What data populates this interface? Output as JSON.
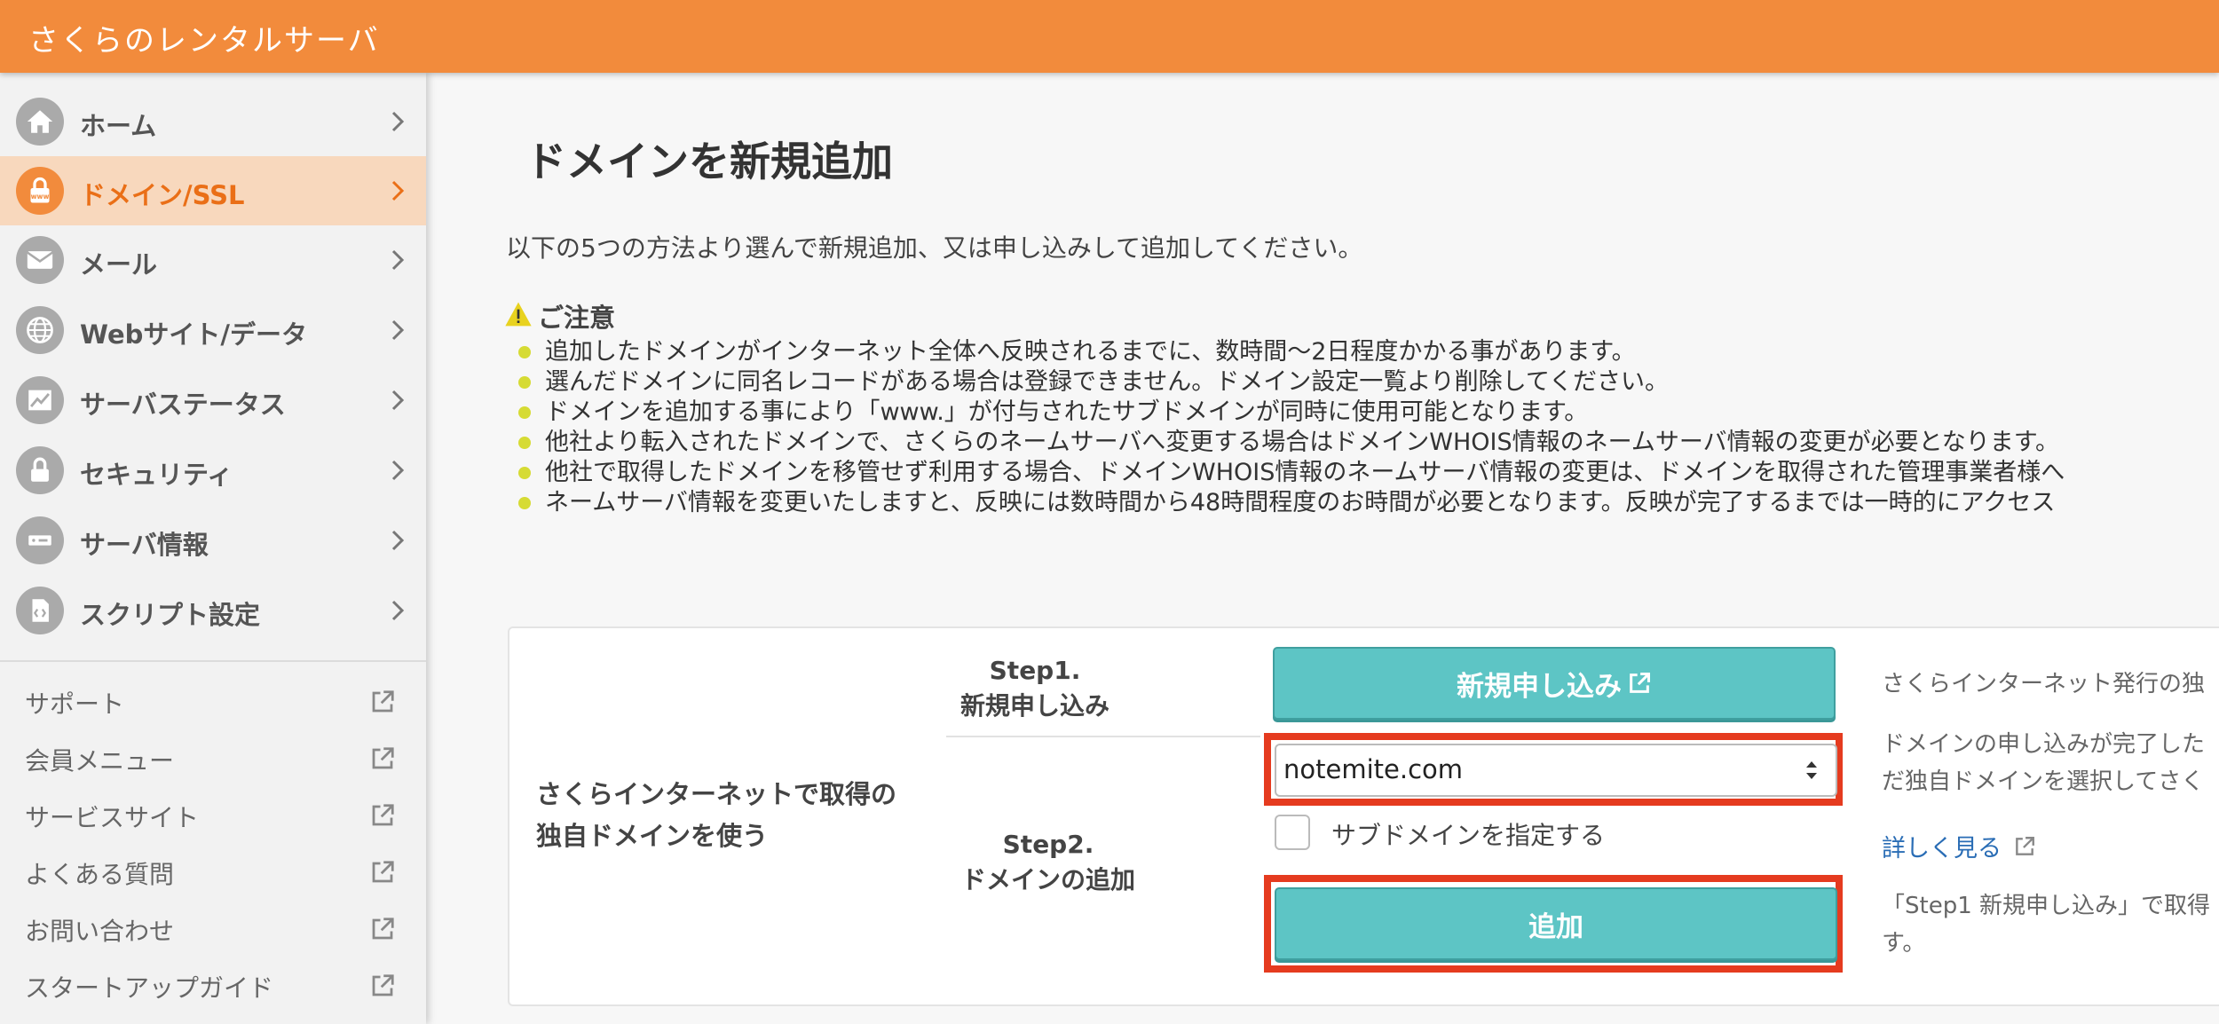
{
  "app": {
    "title": "さくらのレンタルサーバ"
  },
  "sidebar": {
    "items": [
      {
        "label": "ホーム",
        "icon": "home-icon"
      },
      {
        "label": "ドメイン/SSL",
        "icon": "domain-lock-icon",
        "active": true
      },
      {
        "label": "メール",
        "icon": "mail-icon"
      },
      {
        "label": "Webサイト/データ",
        "icon": "globe-icon"
      },
      {
        "label": "サーバステータス",
        "icon": "chart-icon"
      },
      {
        "label": "セキュリティ",
        "icon": "lock-icon"
      },
      {
        "label": "サーバ情報",
        "icon": "server-icon"
      },
      {
        "label": "スクリプト設定",
        "icon": "script-icon"
      }
    ],
    "links": [
      {
        "label": "サポート"
      },
      {
        "label": "会員メニュー"
      },
      {
        "label": "サービスサイト"
      },
      {
        "label": "よくある質問"
      },
      {
        "label": "お問い合わせ"
      },
      {
        "label": "スタートアップガイド"
      }
    ]
  },
  "main": {
    "title": "ドメインを新規追加",
    "intro": "以下の5つの方法より選んで新規追加、又は申し込みして追加してください。",
    "caution": {
      "title": "ご注意",
      "notes": [
        "追加したドメインがインターネット全体へ反映されるまでに、数時間〜2日程度かかる事があります。",
        "選んだドメインに同名レコードがある場合は登録できません。ドメイン設定一覧より削除してください。",
        "ドメインを追加する事により「www.」が付与されたサブドメインが同時に使用可能となります。",
        "他社より転入されたドメインで、さくらのネームサーバへ変更する場合はドメインWHOIS情報のネームサーバ情報の変更が必要となります。",
        "他社で取得したドメインを移管せず利用する場合、ドメインWHOIS情報のネームサーバ情報の変更は、ドメインを取得された管理事業者様へ",
        "ネームサーバ情報を変更いたしますと、反映には数時間から48時間程度のお時間が必要となります。反映が完了するまでは一時的にアクセス"
      ]
    },
    "card": {
      "label": "さくらインターネットで取得の独自ドメインを使う",
      "step1": {
        "line1": "Step1.",
        "line2": "新規申し込み"
      },
      "step2": {
        "line1": "Step2.",
        "line2": "ドメインの追加"
      },
      "apply_button": "新規申し込み",
      "domain_select": "notemite.com",
      "subdomain_checkbox": "サブドメインを指定する",
      "add_button": "追加",
      "side": {
        "text1": "さくらインターネット発行の独",
        "text2_line1": "ドメインの申し込みが完了した",
        "text2_line2": "だ独自ドメインを選択してさく",
        "detail_link": "詳しく見る",
        "text3_line1": "「Step1 新規申し込み」で取得",
        "text3_line2": "す。"
      }
    }
  },
  "colors": {
    "brand": "#f28b3c",
    "active_bg": "#f8d8bd",
    "teal": "#5dc5c5",
    "highlight": "#e53b1f",
    "bullet": "#d6db34",
    "link": "#2a6db5"
  }
}
